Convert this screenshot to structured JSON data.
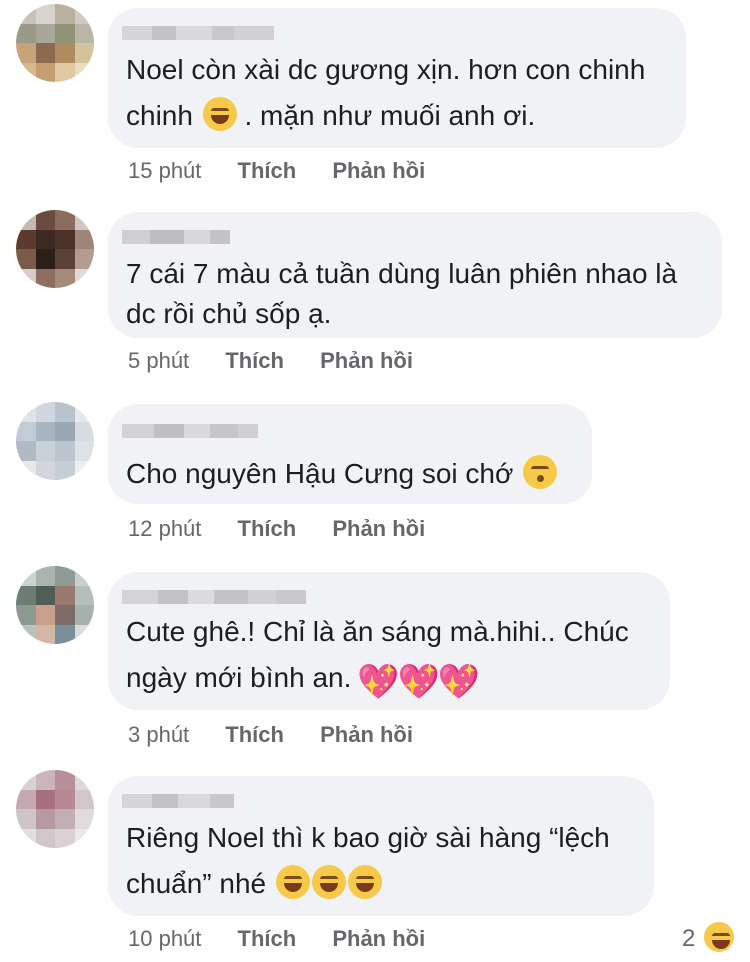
{
  "actions": {
    "like": "Thích",
    "reply": "Phản hồi"
  },
  "comments": [
    {
      "line1": "Noel còn xài dc gương xịn. hơn con chinh",
      "line2": "chinh",
      "line2_after": ". mặn như muối anh ơi.",
      "time": "15 phút",
      "emoji": "laughing-emoji"
    },
    {
      "line1": "7 cái 7 màu cả tuần dùng luân phiên nhao là",
      "line2": "dc rồi chủ sốp ạ.",
      "time": "5 phút"
    },
    {
      "line1": "Cho nguyên Hậu Cưng soi chớ",
      "time": "12 phút",
      "emoji": "kissing-emoji"
    },
    {
      "line1": "Cute ghê.! Chỉ là ăn sáng mà.hihi.. Chúc",
      "line2": "ngày mới bình an.",
      "time": "3 phút",
      "emoji": "sparkling-heart-emoji"
    },
    {
      "line1": "Riêng Noel thì k bao giờ sài hàng “lệch",
      "line2": "chuẩn” nhé",
      "time": "10 phút",
      "emoji": "rofl-emoji",
      "reaction_count": "2"
    }
  ]
}
